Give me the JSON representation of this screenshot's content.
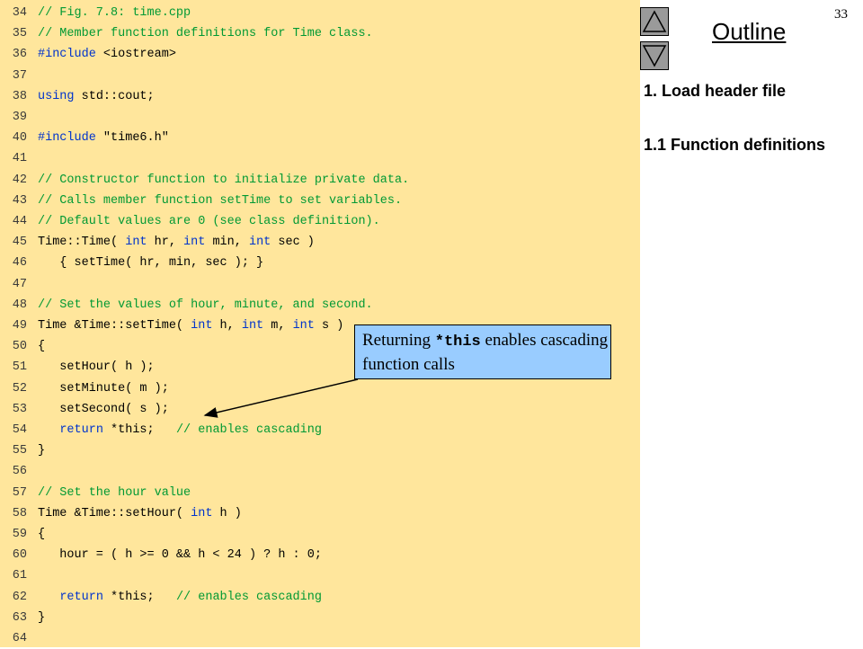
{
  "slide_number": "33",
  "nav": {
    "up_icon": "triangle-up-icon",
    "down_icon": "triangle-down-icon"
  },
  "outline": {
    "title": "Outline",
    "items": [
      "1. Load header file",
      "1.1 Function definitions"
    ]
  },
  "callout": {
    "prefix": "Returning ",
    "code": "*this",
    "suffix": " enables cascading function calls"
  },
  "colors": {
    "code_bg": "#ffe69c",
    "comment": "#009933",
    "keyword": "#0033cc",
    "callout_bg": "#99ccff",
    "nav_button": "#9a9a9a"
  },
  "code_lines": [
    {
      "n": "34",
      "segs": [
        [
          "c",
          "// Fig. 7.8: time.cpp"
        ]
      ]
    },
    {
      "n": "35",
      "segs": [
        [
          "c",
          "// Member function definitions for Time class."
        ]
      ]
    },
    {
      "n": "36",
      "segs": [
        [
          "k",
          "#include"
        ],
        [
          "t",
          " <iostream>"
        ]
      ]
    },
    {
      "n": "37",
      "segs": []
    },
    {
      "n": "38",
      "segs": [
        [
          "k",
          "using"
        ],
        [
          "t",
          " std::cout;"
        ]
      ]
    },
    {
      "n": "39",
      "segs": []
    },
    {
      "n": "40",
      "segs": [
        [
          "k",
          "#include"
        ],
        [
          "t",
          " \"time6.h\""
        ]
      ]
    },
    {
      "n": "41",
      "segs": []
    },
    {
      "n": "42",
      "segs": [
        [
          "c",
          "// Constructor function to initialize private data."
        ]
      ]
    },
    {
      "n": "43",
      "segs": [
        [
          "c",
          "// Calls member function setTime to set variables."
        ]
      ]
    },
    {
      "n": "44",
      "segs": [
        [
          "c",
          "// Default values are 0 (see class definition)."
        ]
      ]
    },
    {
      "n": "45",
      "segs": [
        [
          "t",
          "Time::Time( "
        ],
        [
          "k",
          "int"
        ],
        [
          "t",
          " hr, "
        ],
        [
          "k",
          "int"
        ],
        [
          "t",
          " min, "
        ],
        [
          "k",
          "int"
        ],
        [
          "t",
          " sec )"
        ]
      ]
    },
    {
      "n": "46",
      "segs": [
        [
          "t",
          "   { setTime( hr, min, sec ); }"
        ]
      ]
    },
    {
      "n": "47",
      "segs": []
    },
    {
      "n": "48",
      "segs": [
        [
          "c",
          "// Set the values of hour, minute, and second."
        ]
      ]
    },
    {
      "n": "49",
      "segs": [
        [
          "t",
          "Time &Time::setTime( "
        ],
        [
          "k",
          "int"
        ],
        [
          "t",
          " h, "
        ],
        [
          "k",
          "int"
        ],
        [
          "t",
          " m, "
        ],
        [
          "k",
          "int"
        ],
        [
          "t",
          " s )"
        ]
      ]
    },
    {
      "n": "50",
      "segs": [
        [
          "t",
          "{"
        ]
      ]
    },
    {
      "n": "51",
      "segs": [
        [
          "t",
          "   setHour( h );"
        ]
      ]
    },
    {
      "n": "52",
      "segs": [
        [
          "t",
          "   setMinute( m );"
        ]
      ]
    },
    {
      "n": "53",
      "segs": [
        [
          "t",
          "   setSecond( s );"
        ]
      ]
    },
    {
      "n": "54",
      "segs": [
        [
          "t",
          "   "
        ],
        [
          "k",
          "return"
        ],
        [
          "t",
          " *this;   "
        ],
        [
          "c",
          "// enables cascading"
        ]
      ]
    },
    {
      "n": "55",
      "segs": [
        [
          "t",
          "}"
        ]
      ]
    },
    {
      "n": "56",
      "segs": []
    },
    {
      "n": "57",
      "segs": [
        [
          "c",
          "// Set the hour value"
        ]
      ]
    },
    {
      "n": "58",
      "segs": [
        [
          "t",
          "Time &Time::setHour( "
        ],
        [
          "k",
          "int"
        ],
        [
          "t",
          " h )"
        ]
      ]
    },
    {
      "n": "59",
      "segs": [
        [
          "t",
          "{"
        ]
      ]
    },
    {
      "n": "60",
      "segs": [
        [
          "t",
          "   hour = ( h >= 0 && h < 24 ) ? h : 0;"
        ]
      ]
    },
    {
      "n": "61",
      "segs": []
    },
    {
      "n": "62",
      "segs": [
        [
          "t",
          "   "
        ],
        [
          "k",
          "return"
        ],
        [
          "t",
          " *this;   "
        ],
        [
          "c",
          "// enables cascading"
        ]
      ]
    },
    {
      "n": "63",
      "segs": [
        [
          "t",
          "}"
        ]
      ]
    },
    {
      "n": "64",
      "segs": []
    }
  ]
}
